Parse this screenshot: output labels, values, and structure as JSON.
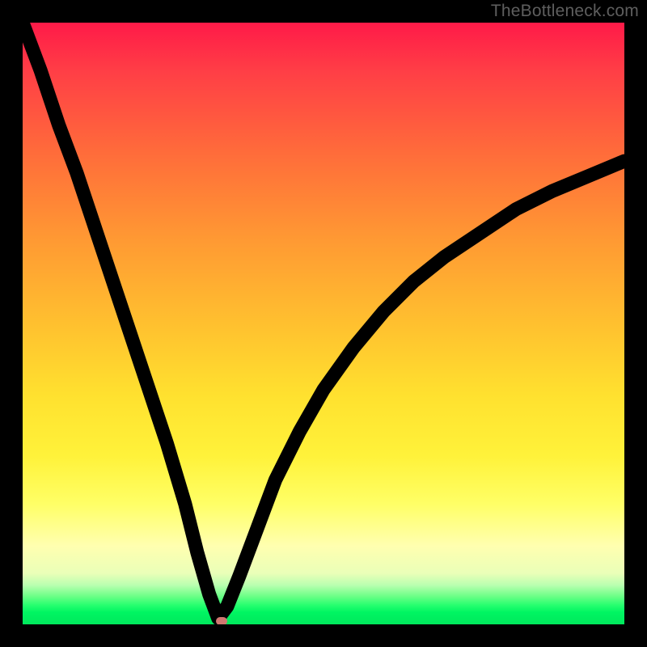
{
  "watermark": "TheBottleneck.com",
  "chart_data": {
    "type": "line",
    "title": "",
    "xlabel": "",
    "ylabel": "",
    "xlim": [
      0,
      100
    ],
    "ylim": [
      0,
      100
    ],
    "grid": false,
    "legend": false,
    "background": "vertical gradient red→orange→yellow→green (bottleneck severity scale)",
    "series": [
      {
        "name": "bottleneck-curve",
        "color": "#000000",
        "x": [
          0,
          3,
          6,
          9,
          12,
          15,
          18,
          21,
          24,
          27,
          29,
          31,
          32.5,
          34,
          36,
          39,
          42,
          46,
          50,
          55,
          60,
          65,
          70,
          76,
          82,
          88,
          94,
          100
        ],
        "values": [
          100,
          92,
          83,
          75,
          66,
          57,
          48,
          39,
          30,
          20,
          12,
          5,
          1,
          3,
          8,
          16,
          24,
          32,
          39,
          46,
          52,
          57,
          61,
          65,
          69,
          72,
          74.5,
          77
        ]
      }
    ],
    "annotations": [
      {
        "name": "optimum-marker",
        "x": 33,
        "y": 0.6,
        "shape": "rounded-pill",
        "color": "#d07770"
      }
    ]
  }
}
